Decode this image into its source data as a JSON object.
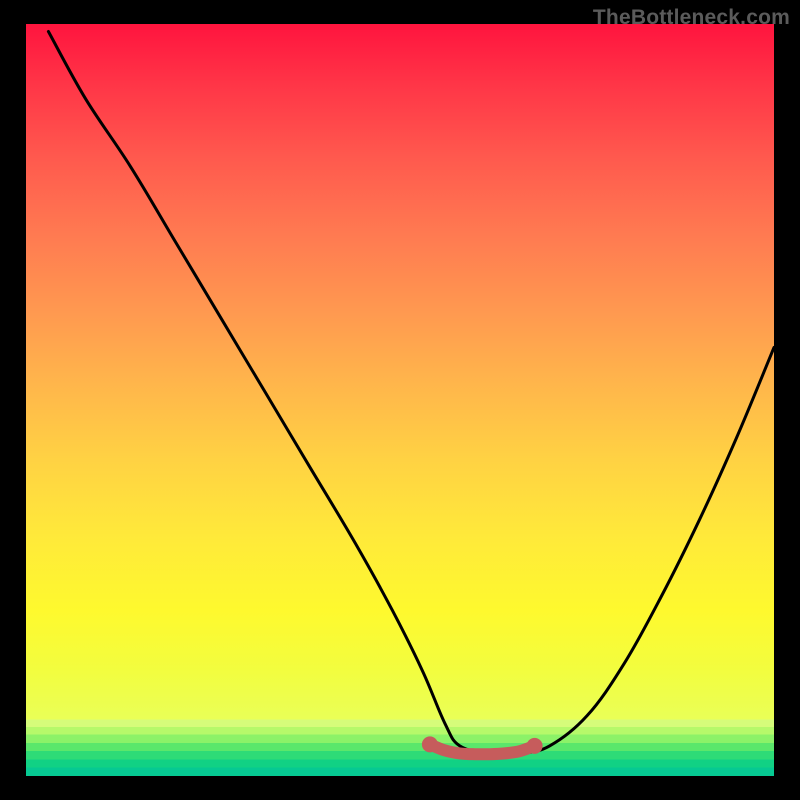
{
  "watermark": "TheBottleneck.com",
  "chart_data": {
    "type": "line",
    "title": "",
    "xlabel": "",
    "ylabel": "",
    "xlim": [
      0,
      100
    ],
    "ylim": [
      0,
      100
    ],
    "grid": false,
    "background_gradient": {
      "top": "#ff143e",
      "middle": "#ffe13c",
      "bottom": "#06c992"
    },
    "series": [
      {
        "name": "bottleneck-curve",
        "color": "#000000",
        "x": [
          3,
          8,
          14,
          20,
          26,
          32,
          38,
          44,
          49,
          53,
          56,
          58,
          62,
          66,
          70,
          75,
          80,
          85,
          90,
          95,
          100
        ],
        "values": [
          99,
          90,
          81,
          71,
          61,
          51,
          41,
          31,
          22,
          14,
          7,
          4,
          3,
          3,
          4,
          8,
          15,
          24,
          34,
          45,
          57
        ]
      },
      {
        "name": "optimal-marker",
        "color": "#cd5c5c",
        "style": "thick-dotted",
        "x": [
          54,
          56,
          58,
          60,
          62,
          64,
          66,
          68
        ],
        "values": [
          4.2,
          3.4,
          3.0,
          2.9,
          2.9,
          3.0,
          3.3,
          4.0
        ]
      }
    ],
    "note": "Values estimated from pixel positions; axes have no visible tick labels."
  }
}
